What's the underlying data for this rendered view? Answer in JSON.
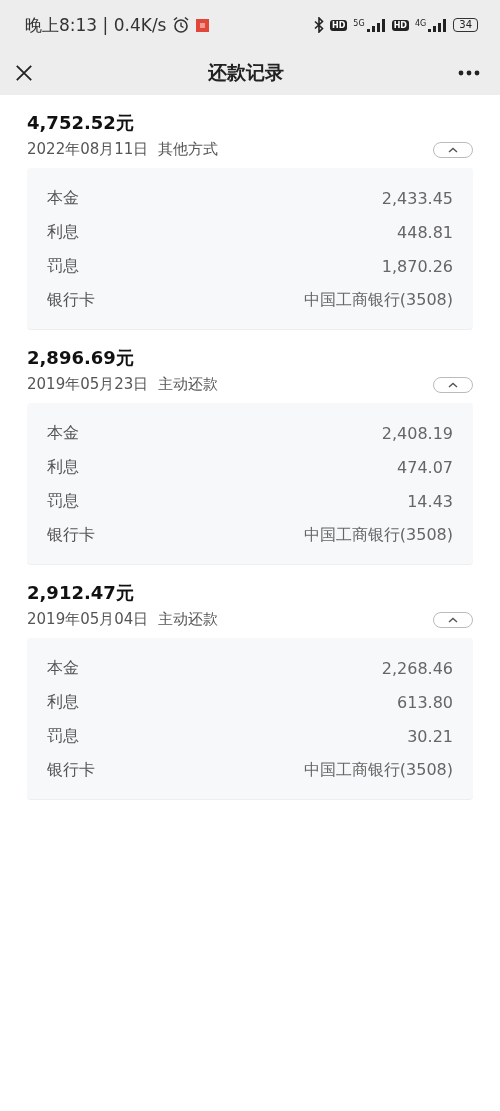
{
  "status_bar": {
    "time": "晚上8:13 | 0.4K/s",
    "sims": [
      {
        "badge": "HD",
        "network": "5G"
      },
      {
        "badge": "HD",
        "network": "4G"
      }
    ],
    "battery": "34"
  },
  "nav": {
    "title": "还款记录"
  },
  "records": [
    {
      "amount": "4,752.52元",
      "date": "2022年08月11日",
      "method": "其他方式",
      "expanded": true,
      "details": [
        {
          "label": "本金",
          "value": "2,433.45"
        },
        {
          "label": "利息",
          "value": "448.81"
        },
        {
          "label": "罚息",
          "value": "1,870.26"
        },
        {
          "label": "银行卡",
          "value": "中国工商银行(3508)"
        }
      ]
    },
    {
      "amount": "2,896.69元",
      "date": "2019年05月23日",
      "method": "主动还款",
      "expanded": true,
      "details": [
        {
          "label": "本金",
          "value": "2,408.19"
        },
        {
          "label": "利息",
          "value": "474.07"
        },
        {
          "label": "罚息",
          "value": "14.43"
        },
        {
          "label": "银行卡",
          "value": "中国工商银行(3508)"
        }
      ]
    },
    {
      "amount": "2,912.47元",
      "date": "2019年05月04日",
      "method": "主动还款",
      "expanded": true,
      "details": [
        {
          "label": "本金",
          "value": "2,268.46"
        },
        {
          "label": "利息",
          "value": "613.80"
        },
        {
          "label": "罚息",
          "value": "30.21"
        },
        {
          "label": "银行卡",
          "value": "中国工商银行(3508)"
        }
      ]
    }
  ]
}
